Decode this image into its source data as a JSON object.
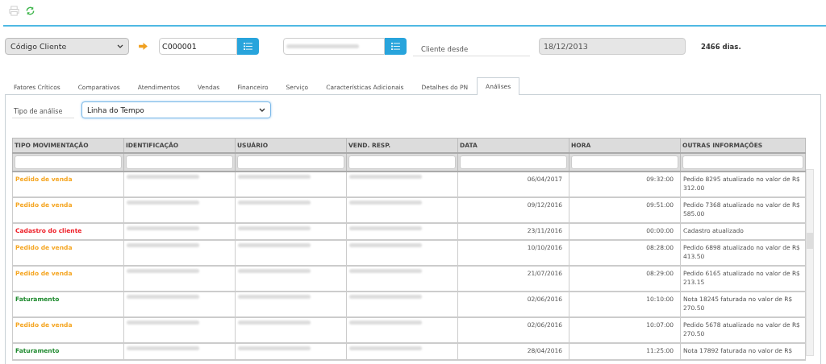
{
  "search": {
    "field_select": "Código Cliente",
    "client_code": "C000001",
    "client_since_label": "Cliente desde",
    "client_since": "18/12/2013",
    "days": "2466 dias."
  },
  "tabs": [
    {
      "label": "Fatores Críticos",
      "selected": false
    },
    {
      "label": "Comparativos",
      "selected": false
    },
    {
      "label": "Atendimentos",
      "selected": false
    },
    {
      "label": "Vendas",
      "selected": false
    },
    {
      "label": "Financeiro",
      "selected": false
    },
    {
      "label": "Serviço",
      "selected": false
    },
    {
      "label": "Características Adicionais",
      "selected": false
    },
    {
      "label": "Detalhes do PN",
      "selected": false
    },
    {
      "label": "Análises",
      "selected": true
    }
  ],
  "analysis": {
    "label": "Tipo de análise",
    "value": "Linha do Tempo"
  },
  "table": {
    "columns": [
      "TIPO MOVIMENTAÇÃO",
      "IDENTIFICAÇÃO",
      "USUÁRIO",
      "VEND. RESP.",
      "DATA",
      "HORA",
      "OUTRAS INFORMAÇÕES"
    ],
    "rows": [
      {
        "type": "Pedido de venda",
        "color": "#f5a623",
        "date": "06/04/2017",
        "time": "09:32:00",
        "info": "Pedido 8295 atualizado no valor de R$ 312.00"
      },
      {
        "type": "Pedido de venda",
        "color": "#f5a623",
        "date": "09/12/2016",
        "time": "09:51:00",
        "info": "Pedido 7368 atualizado no valor de R$ 585.00"
      },
      {
        "type": "Cadastro do cliente",
        "color": "#ee1c25",
        "date": "23/11/2016",
        "time": "00:00:00",
        "info": "Cadastro atualizado"
      },
      {
        "type": "Pedido de venda",
        "color": "#f5a623",
        "date": "10/10/2016",
        "time": "08:28:00",
        "info": "Pedido 6898 atualizado no valor de R$ 413.50"
      },
      {
        "type": "Pedido de venda",
        "color": "#f5a623",
        "date": "21/07/2016",
        "time": "08:29:00",
        "info": "Pedido 6165 atualizado no valor de R$ 213.15"
      },
      {
        "type": "Faturamento",
        "color": "#1e8a2e",
        "date": "02/06/2016",
        "time": "10:10:00",
        "info": "Nota 18245 faturada no valor de R$ 270.50"
      },
      {
        "type": "Pedido de venda",
        "color": "#f5a623",
        "date": "02/06/2016",
        "time": "10:07:00",
        "info": "Pedido 5678 atualizado no valor de R$ 270.50"
      },
      {
        "type": "Faturamento",
        "color": "#1e8a2e",
        "date": "28/04/2016",
        "time": "11:25:00",
        "info": "Nota 17892 faturada no valor de R$"
      }
    ]
  }
}
